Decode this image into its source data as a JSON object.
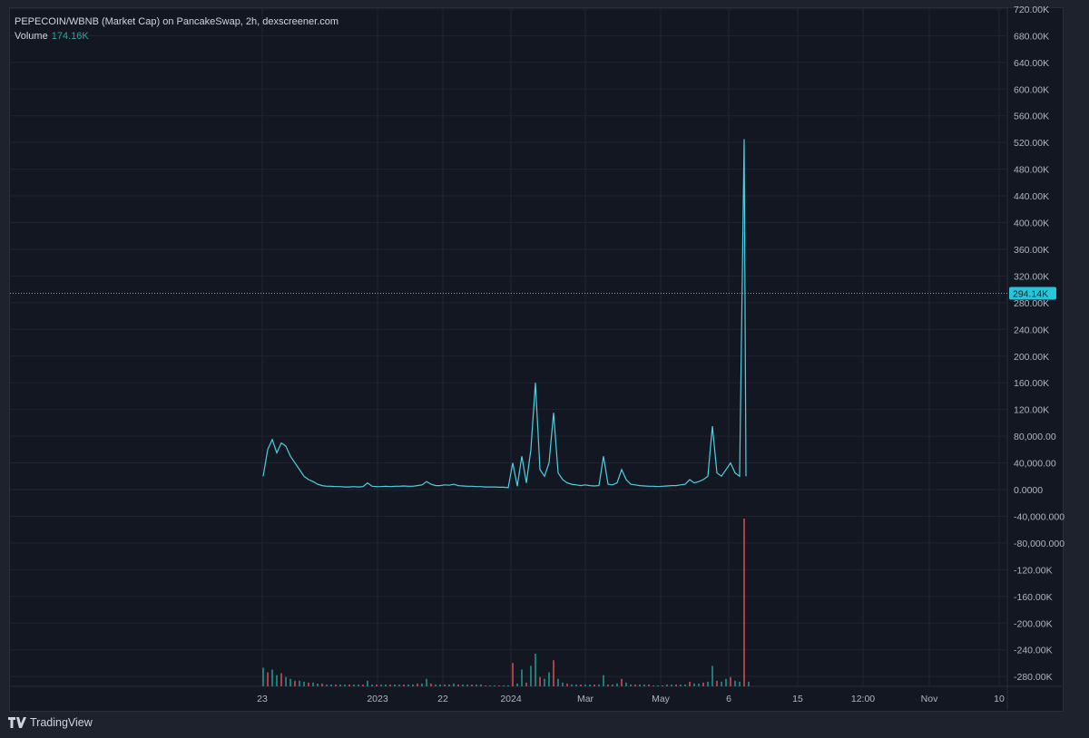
{
  "chart_data": {
    "type": "line",
    "title": "PEPECOIN/WBNB (Market Cap) on PancakeSwap, 2h, dexscreener.com",
    "volume_label": "Volume",
    "volume_value": "174.16K",
    "last_price_label": "294.14K",
    "last_price_value": 294140,
    "ylim": [
      -290000,
      725000
    ],
    "y_ticks": [
      "720.00K",
      "680.00K",
      "640.00K",
      "600.00K",
      "560.00K",
      "520.00K",
      "480.00K",
      "440.00K",
      "400.00K",
      "360.00K",
      "320.00K",
      "280.00K",
      "240.00K",
      "200.00K",
      "160.00K",
      "120.00K",
      "80,000.00",
      "40,000.00",
      "0.0000",
      "-40,000.000",
      "-80,000.000",
      "-120.00K",
      "-160.00K",
      "-200.00K",
      "-240.00K",
      "-280.00K"
    ],
    "y_tick_values": [
      720000,
      680000,
      640000,
      600000,
      560000,
      520000,
      480000,
      440000,
      400000,
      360000,
      320000,
      280000,
      240000,
      200000,
      160000,
      120000,
      80000,
      40000,
      0,
      -40000,
      -80000,
      -120000,
      -160000,
      -200000,
      -240000,
      -280000
    ],
    "x_ticks": [
      "23",
      "2023",
      "22",
      "2024",
      "Mar",
      "May",
      "6",
      "15",
      "12:00",
      "Nov",
      "10"
    ],
    "series": [
      {
        "name": "Market Cap",
        "color": "#4dd0e1",
        "values": [
          20000,
          60000,
          75000,
          55000,
          70000,
          65000,
          50000,
          40000,
          30000,
          20000,
          15000,
          12000,
          8000,
          6000,
          5000,
          5000,
          4500,
          4500,
          4000,
          4000,
          4500,
          4000,
          4500,
          10000,
          5000,
          4500,
          4500,
          5000,
          4500,
          5000,
          5000,
          5500,
          5000,
          5000,
          6000,
          7000,
          12000,
          8000,
          6000,
          6000,
          7000,
          6500,
          8000,
          6000,
          5500,
          5000,
          5000,
          4500,
          4500,
          4000,
          4000,
          4000,
          3500,
          3500,
          3000,
          40000,
          5000,
          50000,
          10000,
          60000,
          160000,
          30000,
          20000,
          40000,
          115000,
          25000,
          15000,
          10000,
          8000,
          7000,
          6000,
          7000,
          6000,
          5500,
          6000,
          50000,
          8000,
          7000,
          10000,
          30000,
          15000,
          8000,
          7000,
          6000,
          5500,
          5000,
          5000,
          4500,
          5000,
          5500,
          6000,
          6000,
          7000,
          8000,
          15000,
          10000,
          12000,
          15000,
          20000,
          95000,
          25000,
          20000,
          30000,
          40000,
          25000,
          20000,
          525000,
          20000
        ]
      }
    ],
    "volume": [
      20,
      15,
      18,
      12,
      14,
      10,
      8,
      6,
      6,
      5,
      4,
      4,
      3,
      3,
      2,
      2,
      2,
      2,
      2,
      2,
      2,
      2,
      2,
      6,
      2,
      2,
      2,
      2,
      2,
      2,
      2,
      2,
      2,
      2,
      3,
      3,
      8,
      3,
      2,
      2,
      2,
      2,
      3,
      2,
      2,
      2,
      2,
      2,
      2,
      1,
      1,
      1,
      1,
      1,
      1,
      25,
      3,
      18,
      4,
      22,
      35,
      10,
      8,
      15,
      28,
      8,
      4,
      3,
      2,
      2,
      2,
      2,
      2,
      2,
      2,
      12,
      2,
      2,
      3,
      8,
      4,
      2,
      2,
      2,
      2,
      2,
      1,
      1,
      1,
      2,
      2,
      2,
      2,
      2,
      5,
      3,
      3,
      4,
      5,
      22,
      6,
      5,
      8,
      10,
      6,
      5,
      180,
      5
    ],
    "grid": true
  },
  "brand": "TradingView",
  "colors": {
    "up": "#26a69a",
    "down": "#ef5350",
    "line": "#4dd0e1",
    "grid": "#1f2431"
  }
}
